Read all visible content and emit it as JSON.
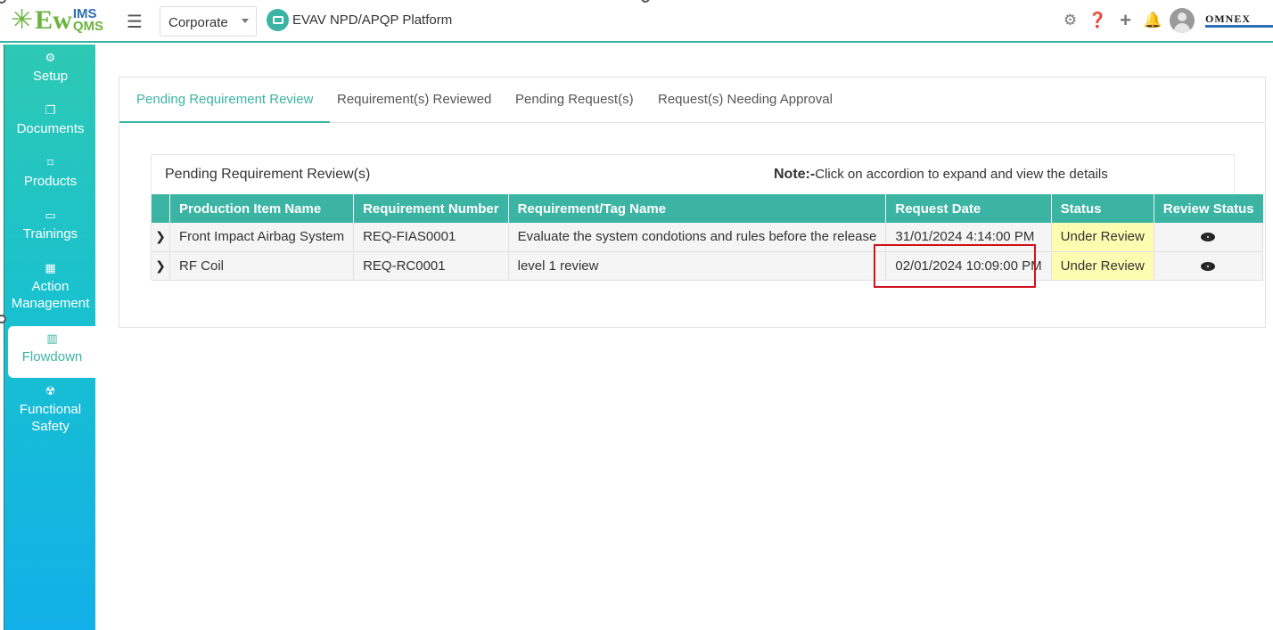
{
  "header": {
    "logo": {
      "mark": "✳",
      "ew": "Ew",
      "ims": "IMS",
      "qms": "QMS"
    },
    "org_select": "Corporate",
    "platform_name": "EVAV NPD/APQP Platform",
    "brand": "OMNEX",
    "icons": [
      "gear-icon",
      "help-icon",
      "plus-icon",
      "bell-icon",
      "user-avatar"
    ]
  },
  "sidebar": {
    "items": [
      {
        "label": "Setup",
        "icon": "gears-icon",
        "glyph": "⚙"
      },
      {
        "label": "Documents",
        "icon": "documents-icon",
        "glyph": "❐"
      },
      {
        "label": "Products",
        "icon": "products-icon",
        "glyph": "⌑"
      },
      {
        "label": "Trainings",
        "icon": "trainings-icon",
        "glyph": "▭"
      },
      {
        "label": "Action Management",
        "icon": "building-icon",
        "glyph": "▦"
      },
      {
        "label": "Flowdown",
        "icon": "flowdown-icon",
        "glyph": "▥"
      },
      {
        "label": "Functional Safety",
        "icon": "safety-icon",
        "glyph": "☢"
      }
    ],
    "active": "Flowdown"
  },
  "tabs": [
    {
      "label": "Pending Requirement Review",
      "active": true
    },
    {
      "label": "Requirement(s) Reviewed",
      "active": false
    },
    {
      "label": "Pending Request(s)",
      "active": false
    },
    {
      "label": "Request(s) Needing Approval",
      "active": false
    }
  ],
  "card": {
    "title": "Pending Requirement Review(s)",
    "note_label": "Note:-",
    "note_text": "Click on accordion to expand and view the details"
  },
  "table": {
    "columns": [
      "",
      "Production Item Name",
      "Requirement Number",
      "Requirement/Tag Name",
      "Request Date",
      "Status",
      "Review Status"
    ],
    "rows": [
      {
        "item": "Front Impact Airbag System",
        "req_no": "REQ-FIAS0001",
        "tag": "Evaluate the system condotions and rules before the release",
        "date": "31/01/2024 4:14:00 PM",
        "status": "Under Review"
      },
      {
        "item": "RF Coil",
        "req_no": "REQ-RC0001",
        "tag": "level 1 review",
        "date": "02/01/2024 10:09:00 PM",
        "status": "Under Review"
      }
    ]
  },
  "colors": {
    "accent": "#3bb4a3",
    "status_bg": "#fdfdb1",
    "highlight": "#d0111b",
    "sidebar_top": "#2ec9b4",
    "sidebar_bottom": "#12b0e8"
  }
}
